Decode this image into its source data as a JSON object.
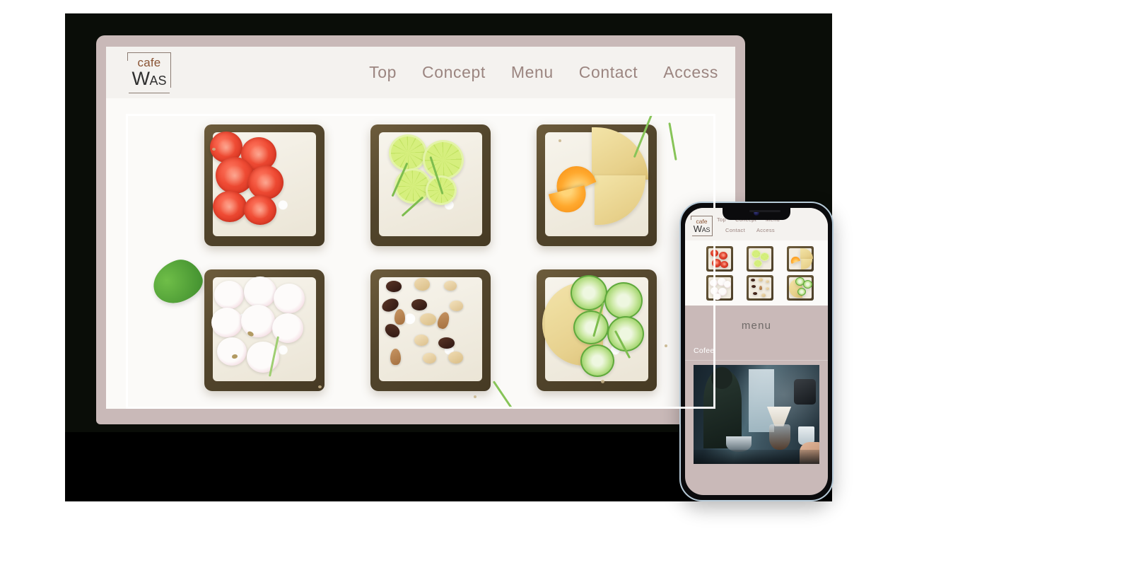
{
  "site": {
    "brand": {
      "cafe_text": "cafe",
      "name_initial": "W",
      "name_rest": "AS"
    },
    "nav": {
      "items": [
        {
          "label": "Top"
        },
        {
          "label": "Concept"
        },
        {
          "label": "Menu"
        },
        {
          "label": "Contact"
        },
        {
          "label": "Access"
        }
      ]
    },
    "hero": {
      "alt": "six open-faced rye toasts with cream cheese and toppings arranged in a 3 by 2 grid on white background",
      "toasts": [
        {
          "topping": "tomato slices with herbs"
        },
        {
          "topping": "lime slices with dill"
        },
        {
          "topping": "cheese wedges with orange slices"
        },
        {
          "topping": "radish slices"
        },
        {
          "topping": "mixed nuts and raisins"
        },
        {
          "topping": "cucumber slices with dill"
        }
      ]
    }
  },
  "mobile": {
    "nav_row_one": [
      {
        "label": "Top"
      },
      {
        "label": "Concept"
      },
      {
        "label": "Menu"
      }
    ],
    "nav_row_two": [
      {
        "label": "Contact"
      },
      {
        "label": "Access"
      }
    ],
    "menu_heading": "menu",
    "section_label": "Cofee",
    "coffee_image_alt": "pour-over coffee brewing station with glass carafes and a kettle"
  },
  "colors": {
    "mauve_frame": "#c9b9b8",
    "header_bg": "#f4f2ef",
    "nav_text": "#9b8580",
    "logo_cafe": "#8a5434",
    "logo_name": "#2f2f2f",
    "monitor_body": "#0a0d08",
    "monitor_stand": "#000000",
    "menu_heading_text": "#6f6a68",
    "section_label_text": "#ffffff"
  }
}
